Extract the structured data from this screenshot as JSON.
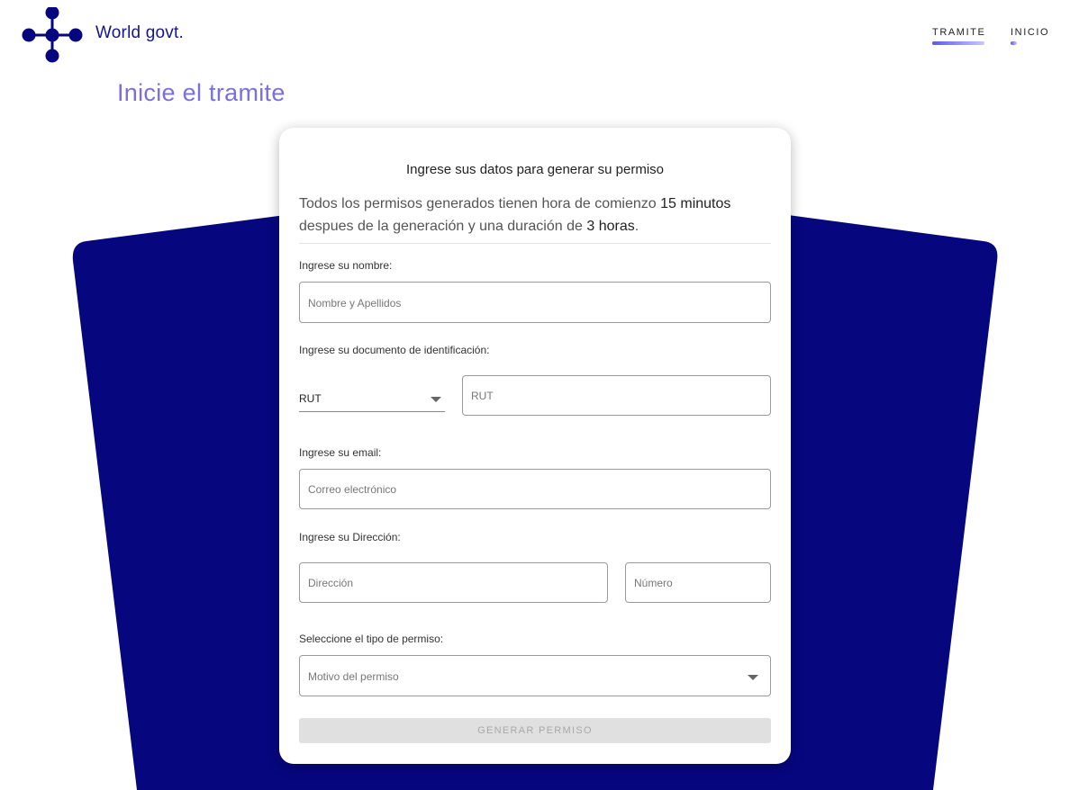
{
  "header": {
    "brand": "World govt.",
    "nav": [
      {
        "label": "TRAMITE",
        "active": true
      },
      {
        "label": "INICIO",
        "active": false
      }
    ]
  },
  "page_title": "Inicie el tramite",
  "card": {
    "title": "Ingrese sus datos para generar su permiso",
    "info": {
      "line1_pre": "Todos los permisos generados tienen hora de comienzo ",
      "line1_bold": "15 minutos",
      "line2_pre": "despues de la generación y una duración de ",
      "line2_bold": "3 horas",
      "line2_post": "."
    },
    "name": {
      "label": "Ingrese su nombre:",
      "placeholder": "Nombre y Apellidos",
      "value": ""
    },
    "document": {
      "label": "Ingrese su documento de identificación:",
      "type_selected": "RUT",
      "placeholder": "RUT",
      "value": ""
    },
    "email": {
      "label": "Ingrese su email:",
      "placeholder": "Correo electrónico",
      "value": ""
    },
    "address": {
      "label": "Ingrese su Dirección:",
      "street_placeholder": "Dirección",
      "number_placeholder": "Número"
    },
    "permit": {
      "label": "Seleccione el tipo de permiso:",
      "placeholder": "Motivo del permiso"
    },
    "submit_label": "GENERAR PERMISO"
  },
  "colors": {
    "brand": "#16168a",
    "background_shape": "#06067f",
    "title": "#7a6fe0",
    "button_disabled": "#e0e0e0"
  }
}
